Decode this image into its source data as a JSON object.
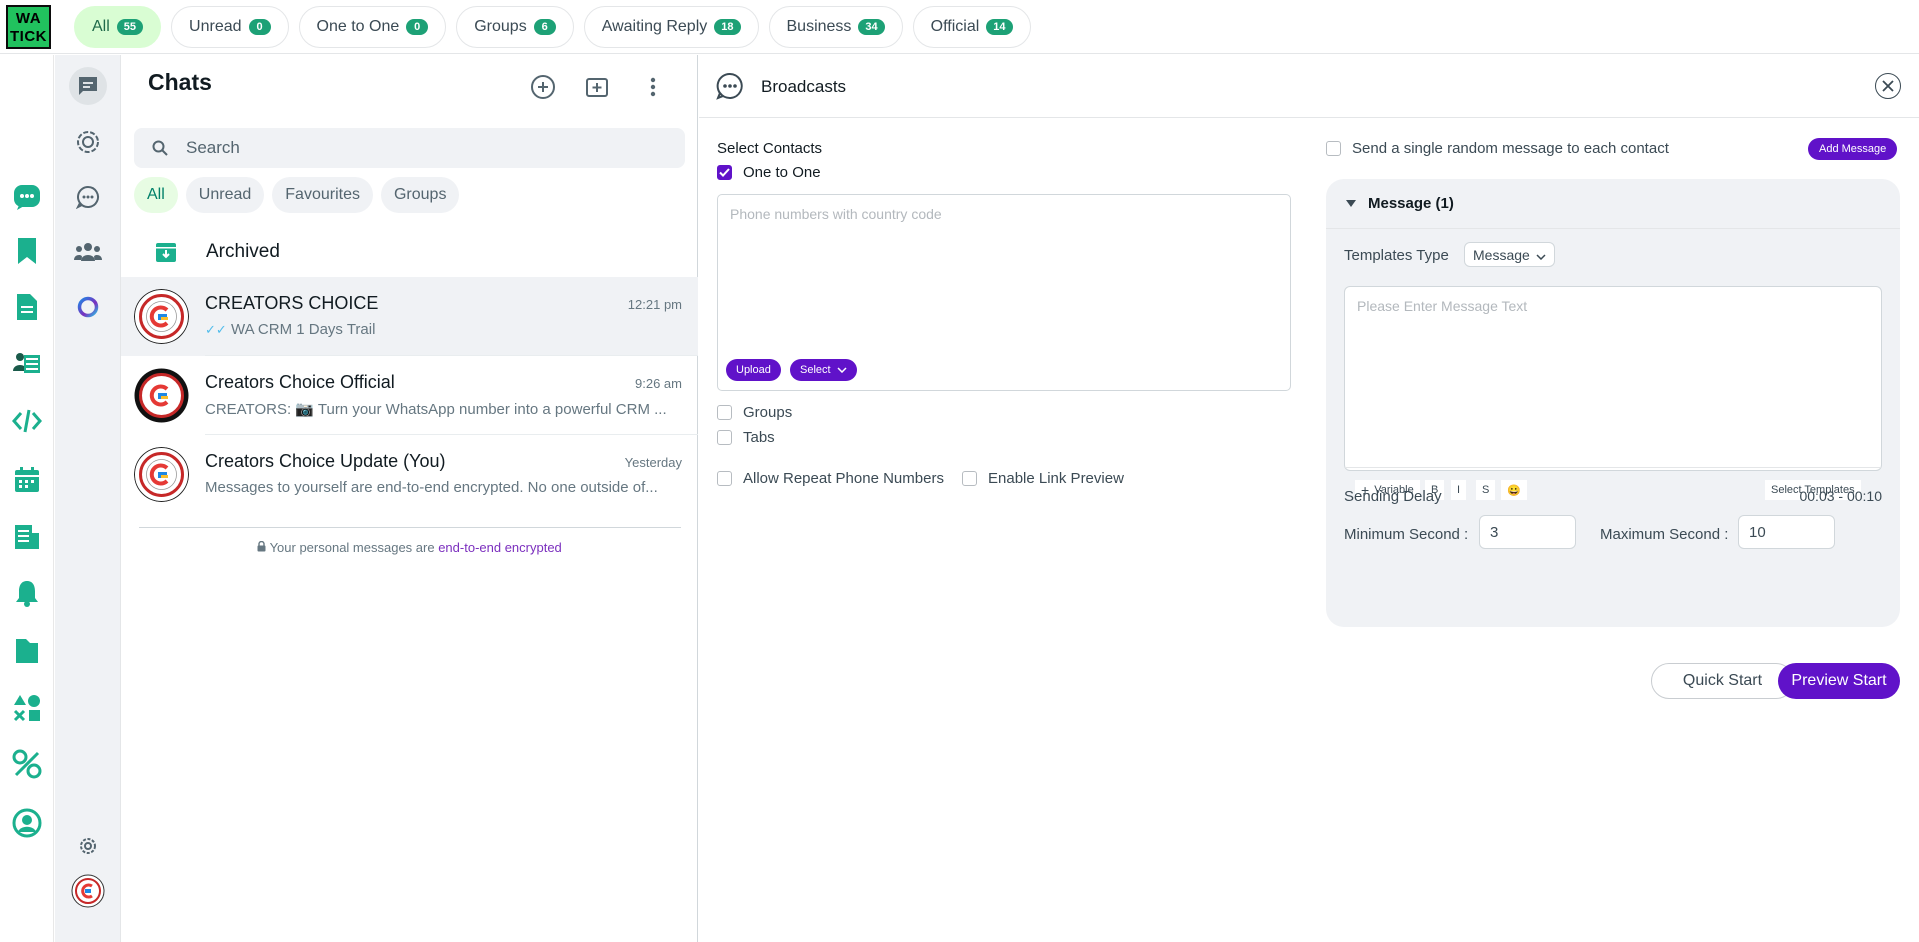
{
  "brand": {
    "logo_line1": "WA",
    "logo_line2": "TICK"
  },
  "filter_tabs": [
    {
      "label": "All",
      "count": "55"
    },
    {
      "label": "Unread",
      "count": "0"
    },
    {
      "label": "One to One",
      "count": "0"
    },
    {
      "label": "Groups",
      "count": "6"
    },
    {
      "label": "Awaiting Reply",
      "count": "18"
    },
    {
      "label": "Business",
      "count": "34"
    },
    {
      "label": "Official",
      "count": "14"
    }
  ],
  "rail_icons": [
    "chat-bubble-icon",
    "bookmark-icon",
    "document-icon",
    "group-spreadsheet-icon",
    "code-icon",
    "calendar-icon",
    "report-icon",
    "bell-icon",
    "folder-icon",
    "shapes-icon",
    "settings-tools-icon",
    "user-circle-icon"
  ],
  "nav2_icons": [
    "chats-icon",
    "status-icon",
    "channels-icon",
    "communities-icon",
    "meta-ai-icon",
    "settings-icon",
    "profile-avatar"
  ],
  "chats": {
    "title": "Chats",
    "search_placeholder": "Search",
    "filters": [
      "All",
      "Unread",
      "Favourites",
      "Groups"
    ],
    "archived_label": "Archived",
    "items": [
      {
        "name": "CREATORS CHOICE",
        "time": "12:21 pm",
        "message": "WA CRM 1 Days Trail"
      },
      {
        "name": "Creators Choice Official",
        "time": "9:26 am",
        "message": "CREATORS: 📷 Turn your WhatsApp number into a powerful CRM ..."
      },
      {
        "name": "Creators Choice Update (You)",
        "time": "Yesterday",
        "message": "Messages to yourself are end-to-end encrypted. No one outside of..."
      }
    ],
    "encrypted_text": "Your personal messages are ",
    "encrypted_link": "end-to-end encrypted"
  },
  "broadcast": {
    "title": "Broadcasts",
    "select_contacts_label": "Select Contacts",
    "one_to_one_label": "One to One",
    "phone_placeholder": "Phone numbers with country code",
    "upload_label": "Upload",
    "select_label": "Select",
    "groups_label": "Groups",
    "tabs_label": "Tabs",
    "allow_repeat_label": "Allow Repeat Phone Numbers",
    "link_preview_label": "Enable Link Preview",
    "random_message_label": "Send a single random message to each contact",
    "add_message_label": "Add Message",
    "message_header": "Message (1)",
    "templates_type_label": "Templates Type",
    "templates_type_value": "Message",
    "message_placeholder": "Please Enter Message Text",
    "toolbar": {
      "variable": "Variable",
      "bold": "B",
      "italic": "I",
      "strike": "S",
      "emoji": "😀",
      "select_templates": "Select Templates"
    },
    "sending_delay_label": "Sending Delay",
    "sending_delay_value": "00:03 - 00:10",
    "min_second_label": "Minimum Second :",
    "min_second_value": "3",
    "max_second_label": "Maximum Second :",
    "max_second_value": "10",
    "quick_start_label": "Quick Start",
    "preview_start_label": "Preview Start"
  },
  "colors": {
    "accent": "#6012c9",
    "brand_green": "#21c25e",
    "icon_green": "#1bb08e",
    "badge_green": "#1da176"
  }
}
